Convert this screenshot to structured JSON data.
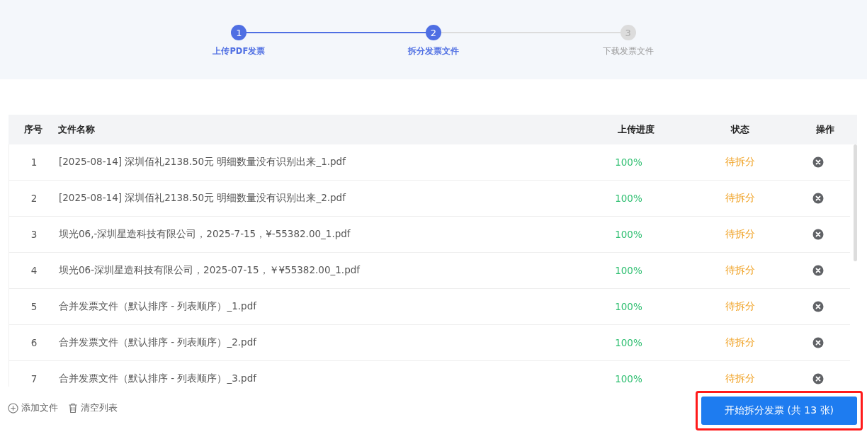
{
  "steps": [
    {
      "number": "1",
      "label": "上传PDF发票",
      "active": true
    },
    {
      "number": "2",
      "label": "拆分发票文件",
      "active": true
    },
    {
      "number": "3",
      "label": "下载发票文件",
      "active": false
    }
  ],
  "table": {
    "columns": [
      "序号",
      "文件名称",
      "上传进度",
      "状态",
      "操作"
    ],
    "rows": [
      {
        "index": "1",
        "name": "[2025-08-14] 深圳佰礼2138.50元 明细数量没有识别出来_1.pdf",
        "progress": "100%",
        "complete": true,
        "status": "待拆分"
      },
      {
        "index": "2",
        "name": "[2025-08-14] 深圳佰礼2138.50元 明细数量没有识别出来_2.pdf",
        "progress": "100%",
        "complete": true,
        "status": "待拆分"
      },
      {
        "index": "3",
        "name": "坝光06,-深圳星造科技有限公司，2025-7-15，¥-55382.00_1.pdf",
        "progress": "100%",
        "complete": true,
        "status": "待拆分"
      },
      {
        "index": "4",
        "name": "坝光06-深圳星造科技有限公司，2025-07-15，￥¥55382.00_1.pdf",
        "progress": "100%",
        "complete": true,
        "status": "待拆分"
      },
      {
        "index": "5",
        "name": "合并发票文件（默认排序 - 列表顺序）_1.pdf",
        "progress": "100%",
        "complete": true,
        "status": "待拆分"
      },
      {
        "index": "6",
        "name": "合并发票文件（默认排序 - 列表顺序）_2.pdf",
        "progress": "100%",
        "complete": true,
        "status": "待拆分"
      },
      {
        "index": "7",
        "name": "合并发票文件（默认排序 - 列表顺序）_3.pdf",
        "progress": "100%",
        "complete": true,
        "status": "待拆分"
      }
    ]
  },
  "footer": {
    "add_link": "添加文件",
    "clear_link": "清空列表",
    "start_button": {
      "label": "开始拆分发票 (共 13 张)",
      "highlighted": true
    }
  }
}
